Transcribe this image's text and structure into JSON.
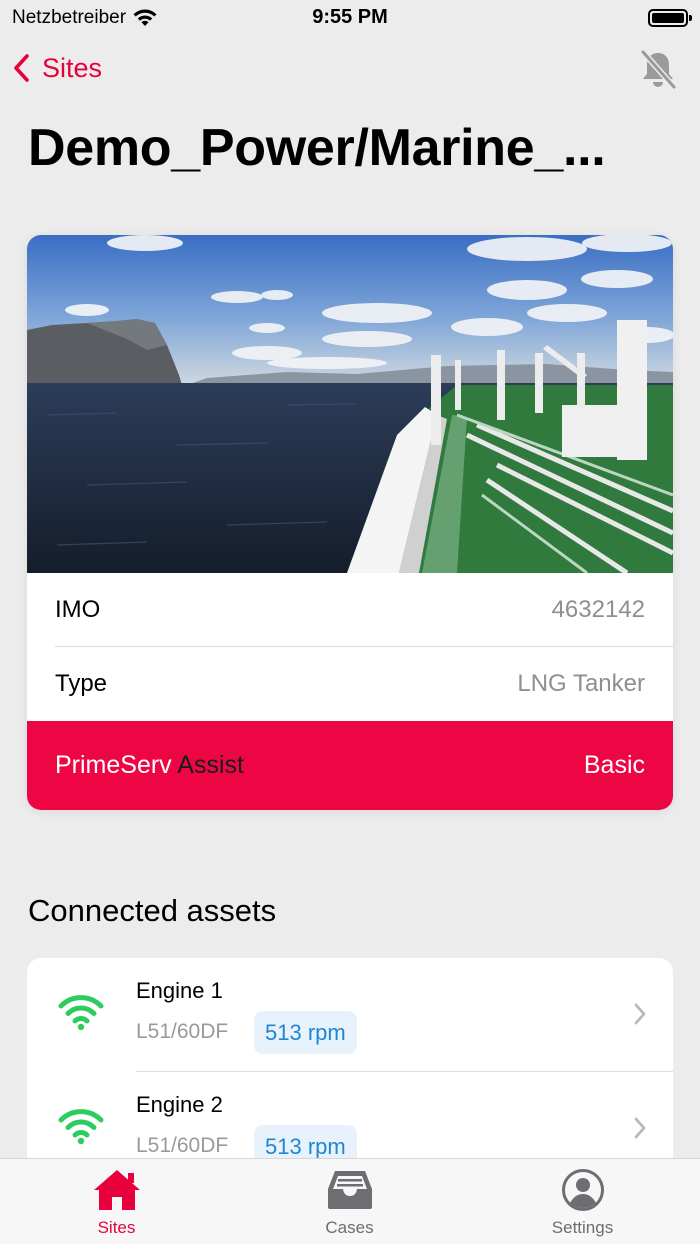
{
  "status_bar": {
    "carrier": "Netzbetreiber",
    "time": "9:55 PM"
  },
  "nav": {
    "back_label": "Sites",
    "back_icon": "chevron-left-icon",
    "notification_icon": "bell-slash-icon"
  },
  "site": {
    "title": "Demo_Power/Marine_...",
    "rows": [
      {
        "label": "IMO",
        "value": "4632142"
      },
      {
        "label": "Type",
        "value": "LNG Tanker"
      }
    ],
    "plan": {
      "name": "PrimeServ",
      "name_suffix": "Assist",
      "level": "Basic"
    }
  },
  "connected_assets": {
    "title": "Connected assets",
    "items": [
      {
        "name": "Engine 1",
        "model": "L51/60DF",
        "speed": "513 rpm",
        "status_icon": "wifi-icon"
      },
      {
        "name": "Engine 2",
        "model": "L51/60DF",
        "speed": "513 rpm",
        "status_icon": "wifi-icon"
      }
    ]
  },
  "tab_bar": {
    "tabs": [
      {
        "label": "Sites",
        "icon": "house-icon",
        "active": true
      },
      {
        "label": "Cases",
        "icon": "tray-icon",
        "active": false
      },
      {
        "label": "Settings",
        "icon": "person-circle-icon",
        "active": false
      }
    ]
  },
  "colors": {
    "accent": "#e8003c",
    "plan_background": "#ee0644",
    "online": "#2ecc5f",
    "rpm_text": "#1f86d1",
    "rpm_background": "#e7f2fc"
  }
}
